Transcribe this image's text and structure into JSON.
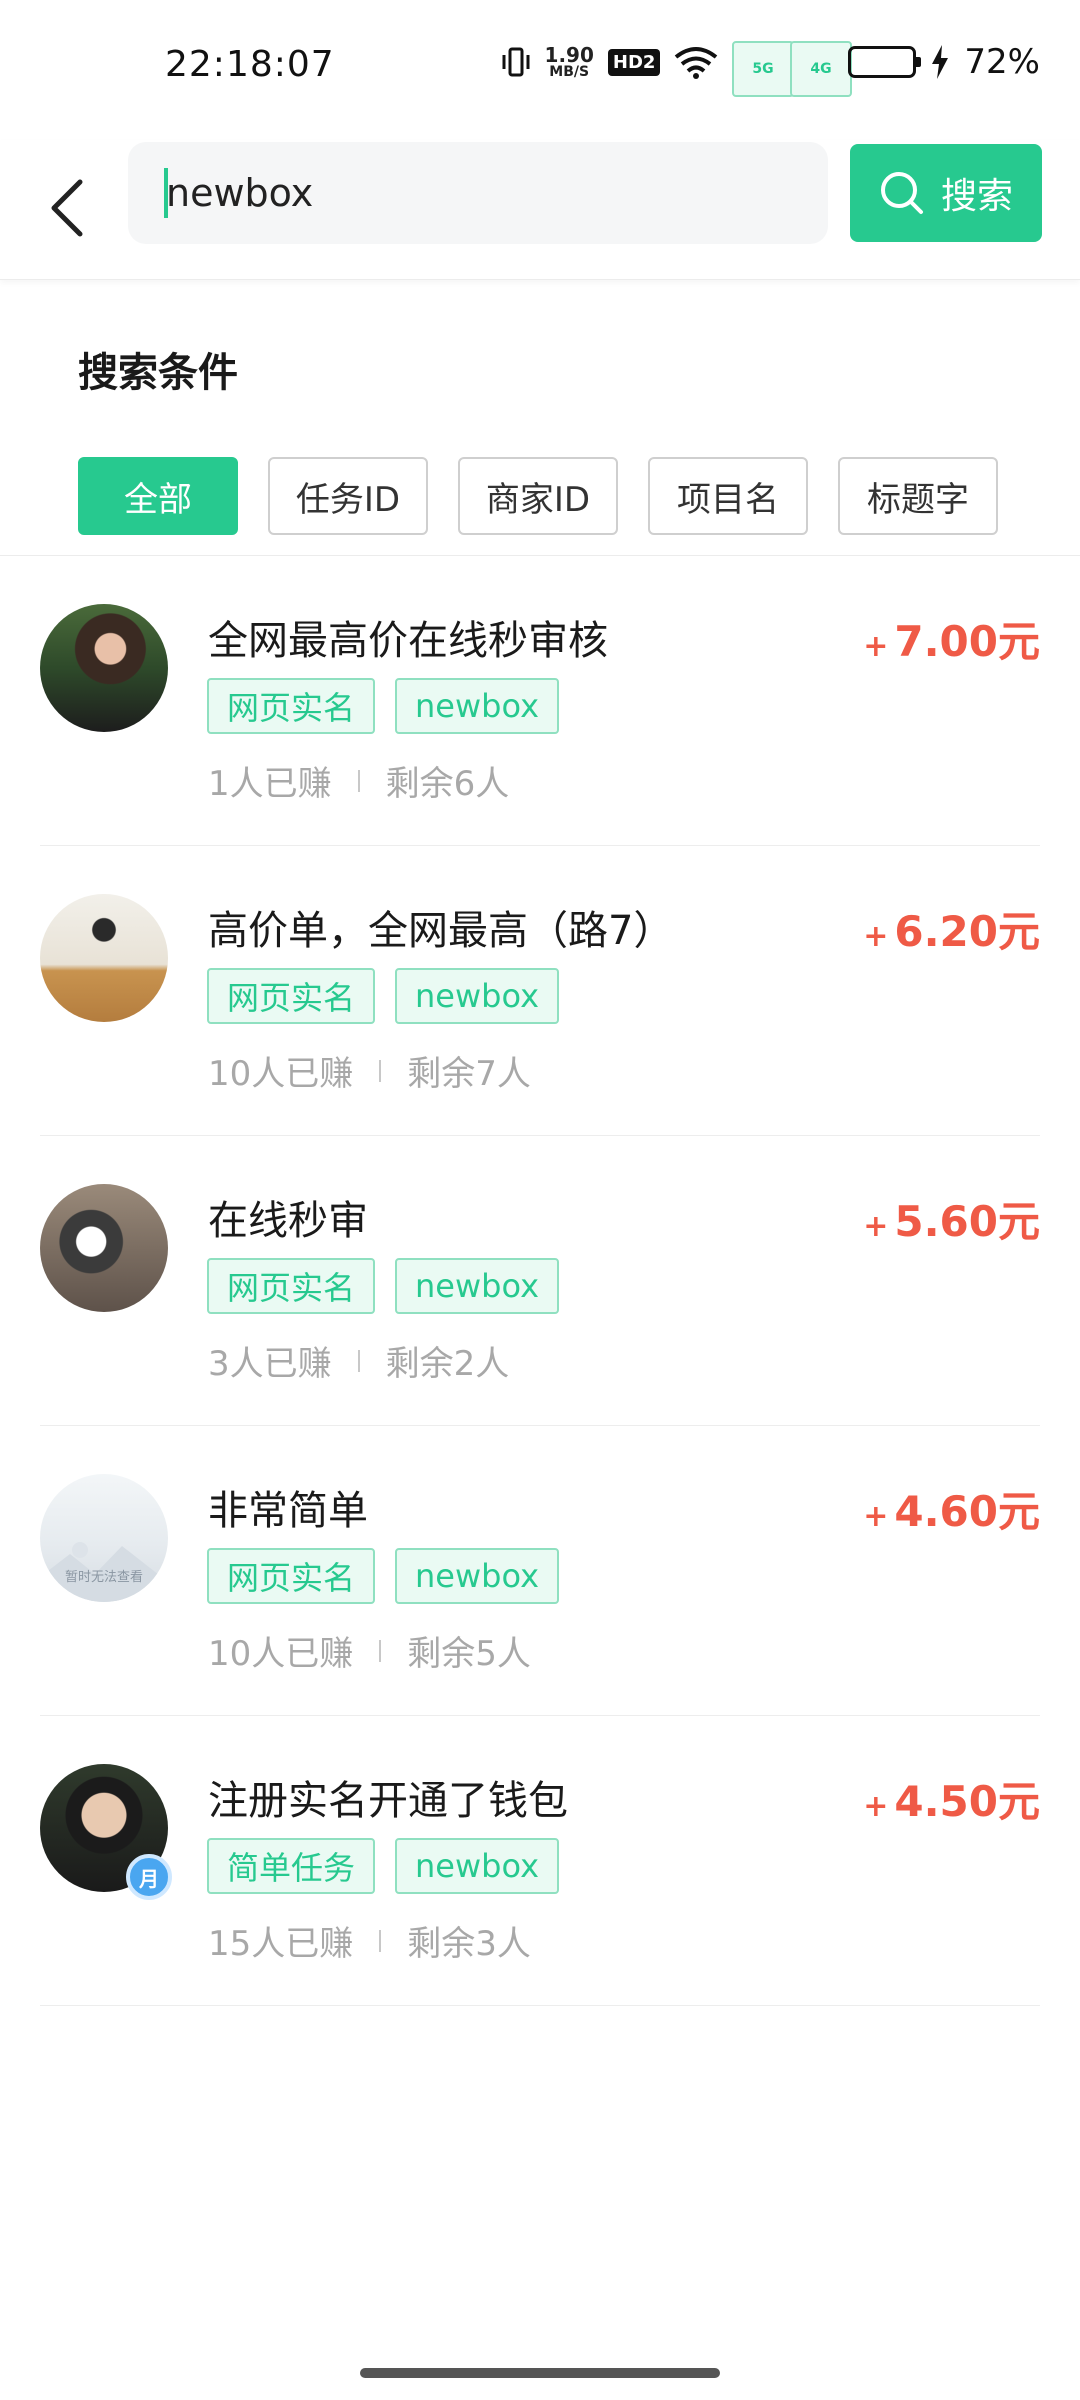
{
  "status_bar": {
    "time": "22:18:07",
    "speed_value": "1.90",
    "speed_unit": "MB/S",
    "hd_label": "HD2",
    "net1": "5G",
    "net2": "4G",
    "battery": "72%"
  },
  "header": {
    "search_value": "newbox",
    "search_button_label": "搜索"
  },
  "filters": {
    "title": "搜索条件",
    "chips": [
      "全部",
      "任务ID",
      "商家ID",
      "项目名",
      "标题字"
    ],
    "active_index": 0
  },
  "tasks": [
    {
      "title": "全网最高价在线秒审核",
      "tags": [
        "网页实名",
        "newbox"
      ],
      "earned": "1人已赚",
      "remaining": "剩余6人",
      "plus": "+",
      "price": "7.00元"
    },
    {
      "title": "高价单，全网最高（路7）",
      "tags": [
        "网页实名",
        "newbox"
      ],
      "earned": "10人已赚",
      "remaining": "剩余7人",
      "plus": "+",
      "price": "6.20元"
    },
    {
      "title": "在线秒审",
      "tags": [
        "网页实名",
        "newbox"
      ],
      "earned": "3人已赚",
      "remaining": "剩余2人",
      "plus": "+",
      "price": "5.60元"
    },
    {
      "title": "非常简单",
      "tags": [
        "网页实名",
        "newbox"
      ],
      "earned": "10人已赚",
      "remaining": "剩余5人",
      "plus": "+",
      "price": "4.60元",
      "avatar_text": "暂时无法查看"
    },
    {
      "title": "注册实名开通了钱包",
      "tags": [
        "简单任务",
        "newbox"
      ],
      "earned": "15人已赚",
      "remaining": "剩余3人",
      "plus": "+",
      "price": "4.50元",
      "badge_text": "月"
    }
  ],
  "colors": {
    "accent": "#27c98f",
    "price": "#ef5a46",
    "tag_bg": "#eafaf3"
  }
}
